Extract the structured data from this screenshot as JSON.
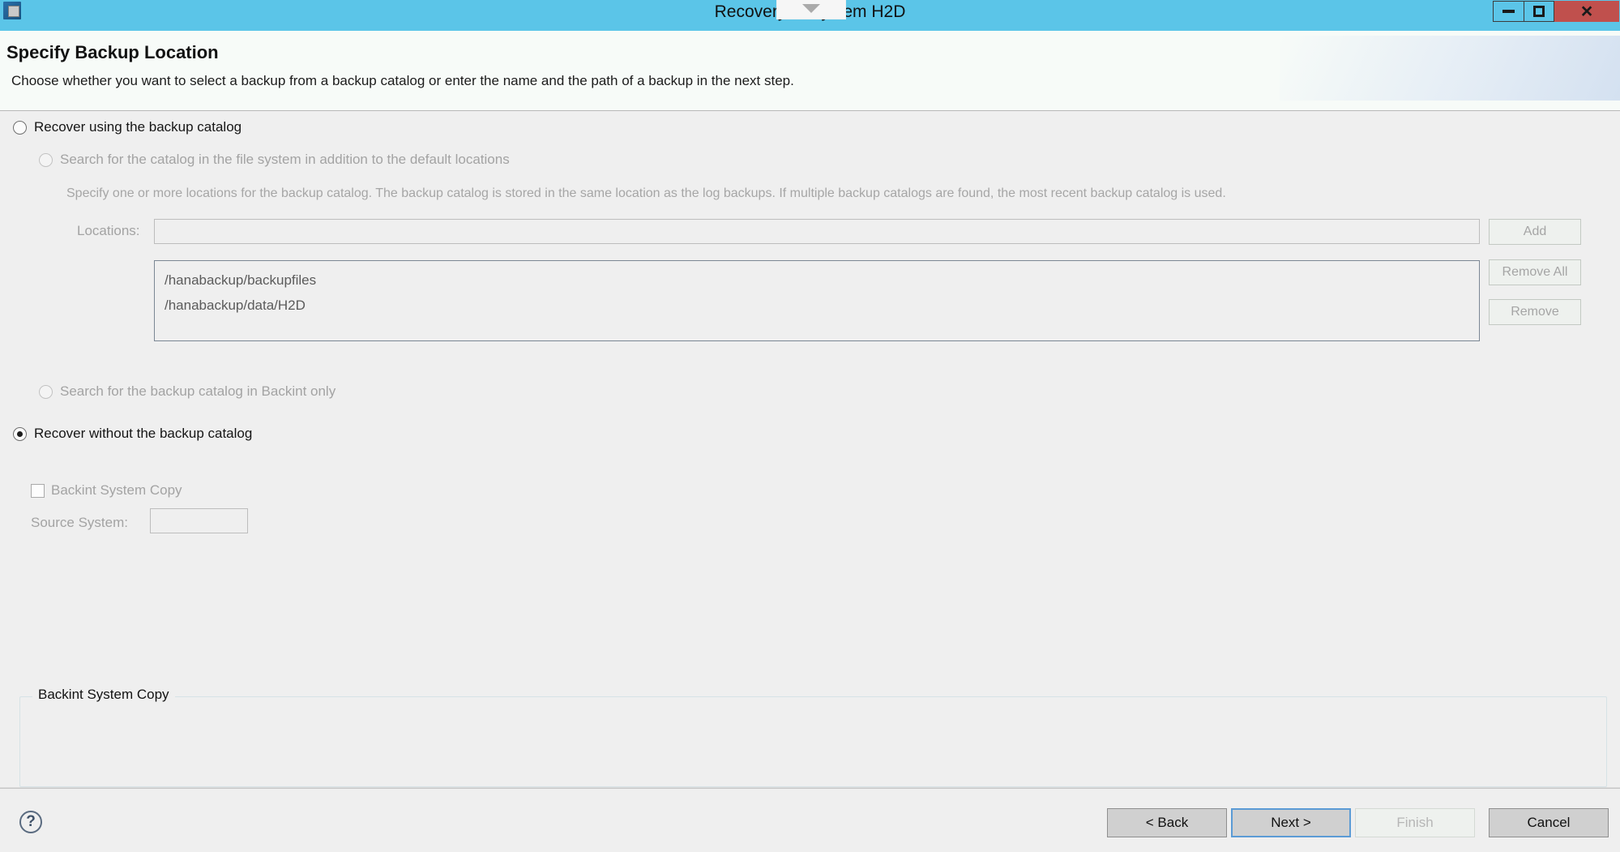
{
  "window": {
    "title": "Recovery of System H2D",
    "app_icon": "application-icon",
    "controls": {
      "minimize": "minimize-icon",
      "maximize": "maximize-icon",
      "close": "×"
    },
    "overlay": {
      "chevron": "chevron-down-icon"
    }
  },
  "header": {
    "title": "Specify Backup Location",
    "description": "Choose whether you want to select a backup from a backup catalog or enter the name and the path of a backup in the next step."
  },
  "options": {
    "recover_using_catalog": {
      "label": "Recover using the backup catalog",
      "selected": false,
      "enabled": true
    },
    "search_file_system": {
      "label": "Search for the catalog in the file system in addition to the default locations",
      "selected": false,
      "enabled": false
    },
    "search_backint_only": {
      "label": "Search for the backup catalog in Backint only",
      "selected": false,
      "enabled": false
    },
    "recover_without_catalog": {
      "label": "Recover without the backup catalog",
      "selected": true,
      "enabled": true
    }
  },
  "catalog_section": {
    "hint": "Specify one or more locations for the backup catalog. The backup catalog is stored in the same location as the log backups. If multiple backup catalogs are found, the most recent backup catalog is used.",
    "locations_label": "Locations:",
    "locations_input_value": "",
    "locations_input_placeholder": "",
    "buttons": {
      "add": "Add",
      "remove_all": "Remove All",
      "remove": "Remove"
    },
    "list_items": [
      "/hanabackup/backupfiles",
      "/hanabackup/data/H2D"
    ]
  },
  "backint_group": {
    "title": "Backint System Copy",
    "checkbox_label": "Backint System Copy",
    "checkbox_checked": false,
    "source_system_label": "Source System:",
    "source_system_value": ""
  },
  "footer": {
    "help_icon": "?",
    "back": "< Back",
    "next": "Next >",
    "finish": "Finish",
    "cancel": "Cancel"
  },
  "colors": {
    "titlebar": "#5bc5e8",
    "close_button": "#c0504d",
    "header_bg": "#f7fbf8",
    "body_bg": "#efefef",
    "default_button_border": "#5b9bd5"
  }
}
